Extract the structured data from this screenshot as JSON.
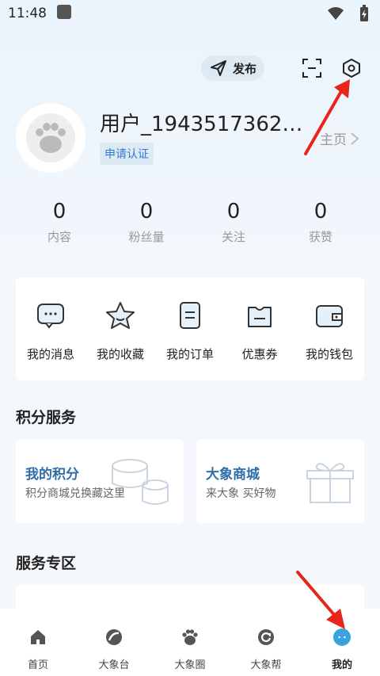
{
  "status_bar": {
    "time": "11:48"
  },
  "header": {
    "publish_label": "发布"
  },
  "profile": {
    "username": "用户_1943517362…",
    "verify_label": "申请认证",
    "home_label": "主页"
  },
  "stats": [
    {
      "value": "0",
      "label": "内容"
    },
    {
      "value": "0",
      "label": "粉丝量"
    },
    {
      "value": "0",
      "label": "关注"
    },
    {
      "value": "0",
      "label": "获赞"
    }
  ],
  "quick_actions": [
    {
      "label": "我的消息",
      "icon": "message-icon"
    },
    {
      "label": "我的收藏",
      "icon": "star-icon"
    },
    {
      "label": "我的订单",
      "icon": "order-icon"
    },
    {
      "label": "优惠券",
      "icon": "coupon-icon"
    },
    {
      "label": "我的钱包",
      "icon": "wallet-icon"
    }
  ],
  "points_section": {
    "title": "积分服务",
    "cards": [
      {
        "title": "我的积分",
        "subtitle": "积分商城兑换藏这里",
        "icon": "coins-icon"
      },
      {
        "title": "大象商城",
        "subtitle": "来大象  买好物",
        "icon": "gift-icon"
      }
    ]
  },
  "service_section": {
    "title": "服务专区"
  },
  "tabbar": [
    {
      "label": "首页",
      "icon": "home-icon"
    },
    {
      "label": "大象台",
      "icon": "broadcast-icon"
    },
    {
      "label": "大象圈",
      "icon": "paw-icon"
    },
    {
      "label": "大象帮",
      "icon": "refresh-icon"
    },
    {
      "label": "我的",
      "icon": "profile-icon"
    }
  ],
  "colors": {
    "accent": "#2f7bd1",
    "annotation_arrow": "#e8251c"
  }
}
